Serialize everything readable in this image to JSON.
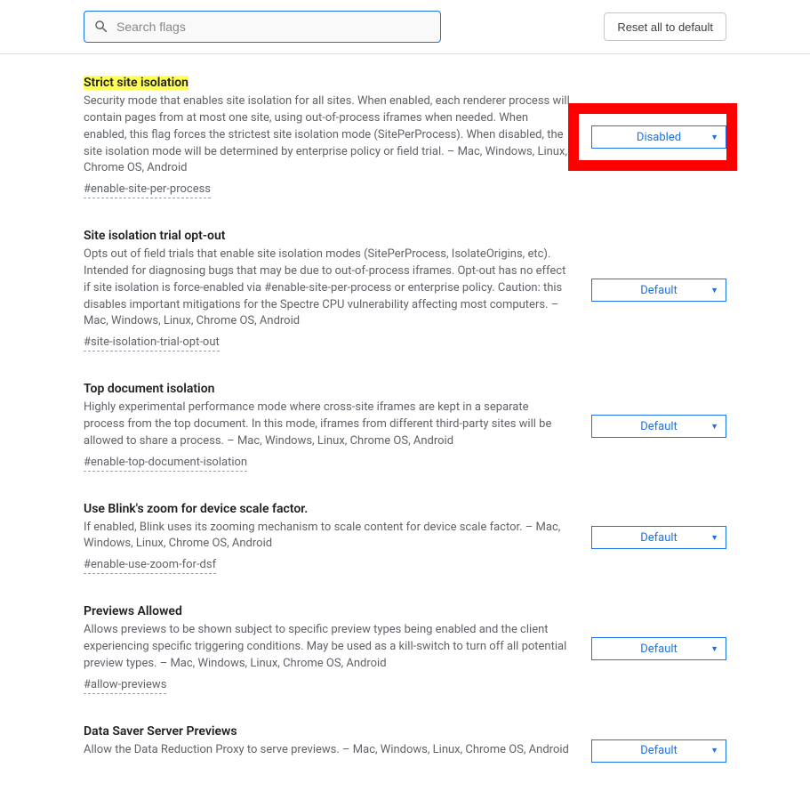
{
  "header": {
    "search_placeholder": "Search flags",
    "reset_label": "Reset all to default"
  },
  "flags": [
    {
      "title": "Strict site isolation",
      "highlight": true,
      "desc": "Security mode that enables site isolation for all sites. When enabled, each renderer process will contain pages from at most one site, using out-of-process iframes when needed. When enabled, this flag forces the strictest site isolation mode (SitePerProcess). When disabled, the site isolation mode will be determined by enterprise policy or field trial. – Mac, Windows, Linux, Chrome OS, Android",
      "hash": "#enable-site-per-process",
      "select": "Disabled",
      "redbox": true
    },
    {
      "title": "Site isolation trial opt-out",
      "highlight": false,
      "desc": "Opts out of field trials that enable site isolation modes (SitePerProcess, IsolateOrigins, etc). Intended for diagnosing bugs that may be due to out-of-process iframes. Opt-out has no effect if site isolation is force-enabled via #enable-site-per-process or enterprise policy. Caution: this disables important mitigations for the Spectre CPU vulnerability affecting most computers. – Mac, Windows, Linux, Chrome OS, Android",
      "hash": "#site-isolation-trial-opt-out",
      "select": "Default",
      "redbox": false
    },
    {
      "title": "Top document isolation",
      "highlight": false,
      "desc": "Highly experimental performance mode where cross-site iframes are kept in a separate process from the top document. In this mode, iframes from different third-party sites will be allowed to share a process. – Mac, Windows, Linux, Chrome OS, Android",
      "hash": "#enable-top-document-isolation",
      "select": "Default",
      "redbox": false
    },
    {
      "title": "Use Blink's zoom for device scale factor.",
      "highlight": false,
      "desc": "If enabled, Blink uses its zooming mechanism to scale content for device scale factor. – Mac, Windows, Linux, Chrome OS, Android",
      "hash": "#enable-use-zoom-for-dsf",
      "select": "Default",
      "redbox": false
    },
    {
      "title": "Previews Allowed",
      "highlight": false,
      "desc": "Allows previews to be shown subject to specific preview types being enabled and the client experiencing specific triggering conditions. May be used as a kill-switch to turn off all potential preview types. – Mac, Windows, Linux, Chrome OS, Android",
      "hash": "#allow-previews",
      "select": "Default",
      "redbox": false
    },
    {
      "title": "Data Saver Server Previews",
      "highlight": false,
      "desc": "Allow the Data Reduction Proxy to serve previews. – Mac, Windows, Linux, Chrome OS, Android",
      "hash": "",
      "select": "Default",
      "redbox": false
    }
  ]
}
